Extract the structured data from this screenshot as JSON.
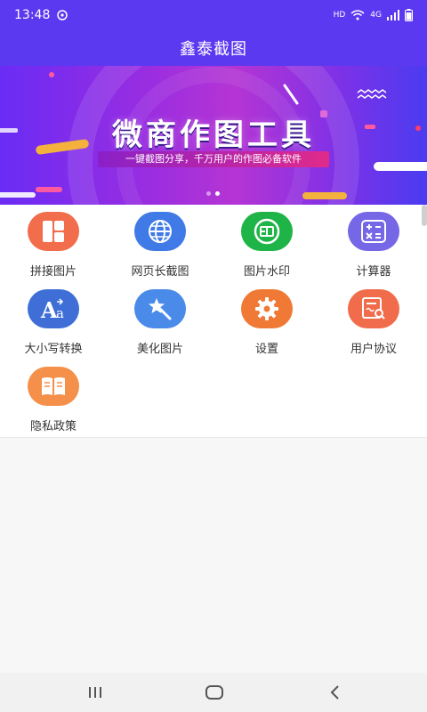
{
  "status_bar": {
    "time": "13:48",
    "hd": "HD",
    "net": "4G"
  },
  "header": {
    "title": "鑫泰截图"
  },
  "banner": {
    "title": "微商作图工具",
    "subtitle": "一键截图分享，千万用户的作图必备软件",
    "slide_count": 2,
    "active_slide": 1
  },
  "grid": {
    "items": [
      {
        "label": "拼接图片",
        "icon": "puzzle-grid-icon",
        "color": "#f26d4c"
      },
      {
        "label": "网页长截图",
        "icon": "globe-icon",
        "color": "#3f7ae6"
      },
      {
        "label": "图片水印",
        "icon": "watermark-badge-icon",
        "color": "#1fb447"
      },
      {
        "label": "计算器",
        "icon": "calculator-icon",
        "color": "#7667e6"
      },
      {
        "label": "大小写转换",
        "icon": "case-convert-icon",
        "color": "#3f6fd6"
      },
      {
        "label": "美化图片",
        "icon": "magic-wand-icon",
        "color": "#4a8ae8"
      },
      {
        "label": "设置",
        "icon": "gear-icon",
        "color": "#f07a35"
      },
      {
        "label": "用户协议",
        "icon": "document-search-icon",
        "color": "#f06c4a"
      },
      {
        "label": "隐私政策",
        "icon": "open-book-icon",
        "color": "#f4904a"
      }
    ]
  },
  "nav": {
    "recents": "recents-icon",
    "home": "home-icon",
    "back": "back-icon"
  }
}
